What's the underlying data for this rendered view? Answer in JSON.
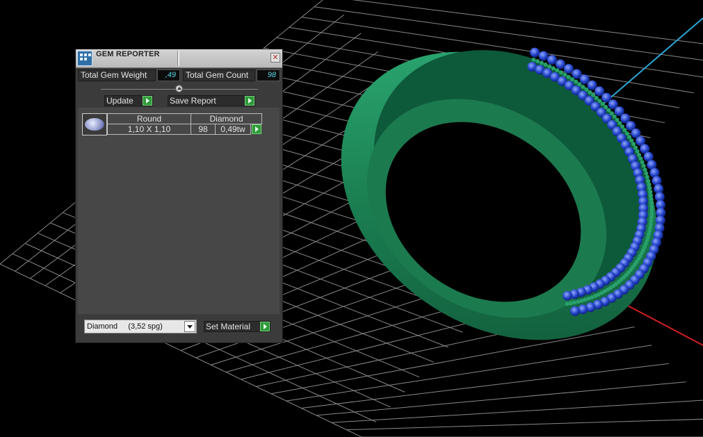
{
  "app": {
    "title": "GEM REPORTER",
    "close_glyph": "✕"
  },
  "icons": {
    "window": "gem-reporter-icon",
    "close": "close-icon",
    "go": "green-arrow-icon",
    "gem": "round-gem-icon",
    "dropdown": "chevron-down-icon"
  },
  "stats": {
    "weight_label": "Total Gem Weight",
    "weight_value": ",49",
    "count_label": "Total Gem Count",
    "count_value": "98"
  },
  "actions": {
    "update": "Update",
    "save_report": "Save Report"
  },
  "gem_table": {
    "rows": [
      {
        "shape": "Round",
        "material": "Diamond",
        "size": "1,10 X 1,10",
        "count": "98",
        "weight": "0,49tw"
      }
    ]
  },
  "material": {
    "selected": "Diamond     (3,52 spg)",
    "set_label": "Set Material"
  },
  "colors": {
    "ring": "#1f8a5a",
    "gem": "#2146c8",
    "grid": "#9a9a9a",
    "axis_x": "#d02020",
    "axis_y": "#2aa6d6",
    "accent_go": "#2f9a3a"
  }
}
